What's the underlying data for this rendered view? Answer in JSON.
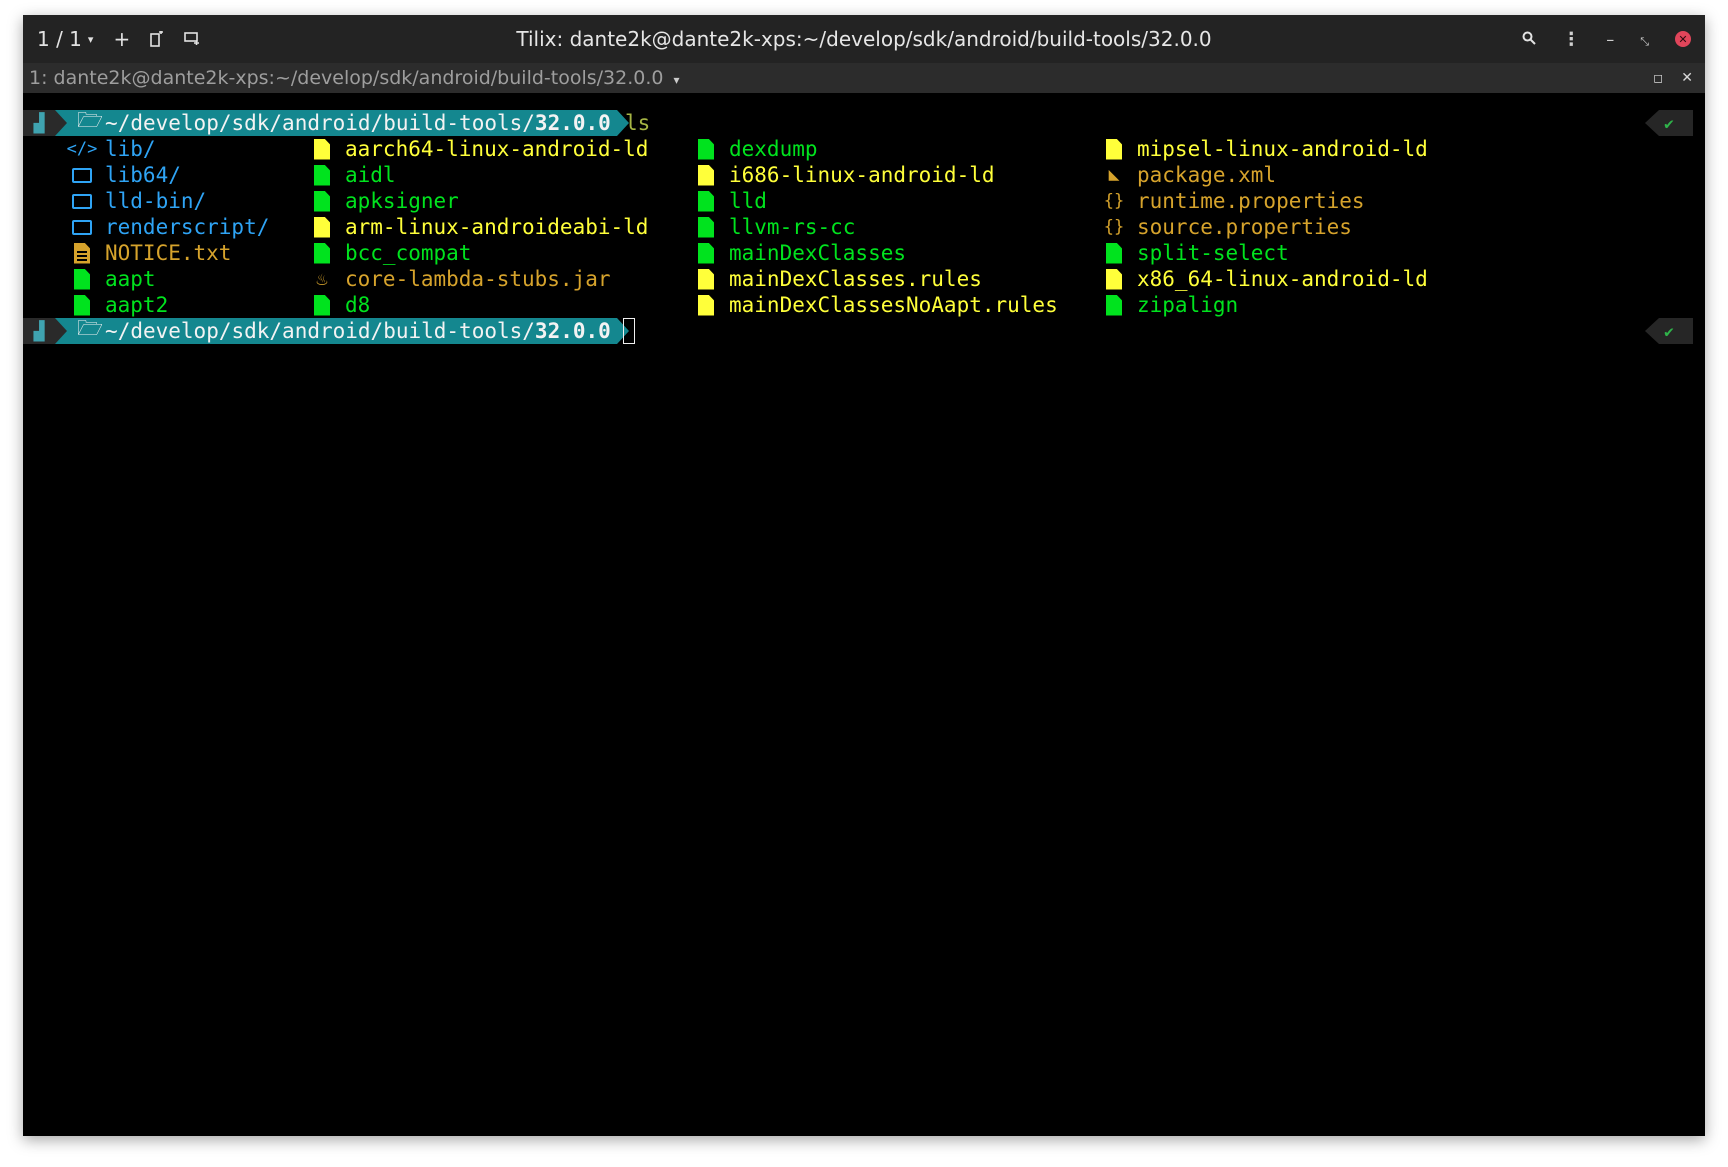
{
  "titlebar": {
    "session_count": "1 / 1",
    "title": "Tilix: dante2k@dante2k-xps:~/develop/sdk/android/build-tools/32.0.0"
  },
  "terminal_bar": {
    "title": "1: dante2k@dante2k-xps:~/develop/sdk/android/build-tools/32.0.0"
  },
  "prompt": {
    "path_prefix": "~/develop/sdk/android/build-tools/",
    "path_current": "32.0.0",
    "command": "ls",
    "status": "✔"
  },
  "listing": {
    "col1": [
      {
        "name": "lib/",
        "kind": "code-dir"
      },
      {
        "name": "lib64/",
        "kind": "dir"
      },
      {
        "name": "lld-bin/",
        "kind": "dir"
      },
      {
        "name": "renderscript/",
        "kind": "dir"
      },
      {
        "name": "NOTICE.txt",
        "kind": "txt"
      },
      {
        "name": "aapt",
        "kind": "exec"
      },
      {
        "name": "aapt2",
        "kind": "exec"
      }
    ],
    "col2": [
      {
        "name": "aarch64-linux-android-ld",
        "kind": "ld"
      },
      {
        "name": "aidl",
        "kind": "exec"
      },
      {
        "name": "apksigner",
        "kind": "exec"
      },
      {
        "name": "arm-linux-androideabi-ld",
        "kind": "ld"
      },
      {
        "name": "bcc_compat",
        "kind": "exec"
      },
      {
        "name": "core-lambda-stubs.jar",
        "kind": "jar"
      },
      {
        "name": "d8",
        "kind": "exec"
      }
    ],
    "col3": [
      {
        "name": "dexdump",
        "kind": "exec"
      },
      {
        "name": "i686-linux-android-ld",
        "kind": "ld"
      },
      {
        "name": "lld",
        "kind": "exec"
      },
      {
        "name": "llvm-rs-cc",
        "kind": "exec"
      },
      {
        "name": "mainDexClasses",
        "kind": "exec"
      },
      {
        "name": "mainDexClasses.rules",
        "kind": "ld"
      },
      {
        "name": "mainDexClassesNoAapt.rules",
        "kind": "ld"
      }
    ],
    "col4": [
      {
        "name": "mipsel-linux-android-ld",
        "kind": "ld"
      },
      {
        "name": "package.xml",
        "kind": "xml"
      },
      {
        "name": "runtime.properties",
        "kind": "json"
      },
      {
        "name": "source.properties",
        "kind": "json"
      },
      {
        "name": "split-select",
        "kind": "exec"
      },
      {
        "name": "x86_64-linux-android-ld",
        "kind": "ld"
      },
      {
        "name": "zipalign",
        "kind": "exec"
      }
    ]
  },
  "colors": {
    "exec": "#00e31e",
    "ld": "#ffff3a",
    "dir": "#2fa4f5",
    "misc": "#d6a32c",
    "prompt_bg": "#14878f"
  }
}
